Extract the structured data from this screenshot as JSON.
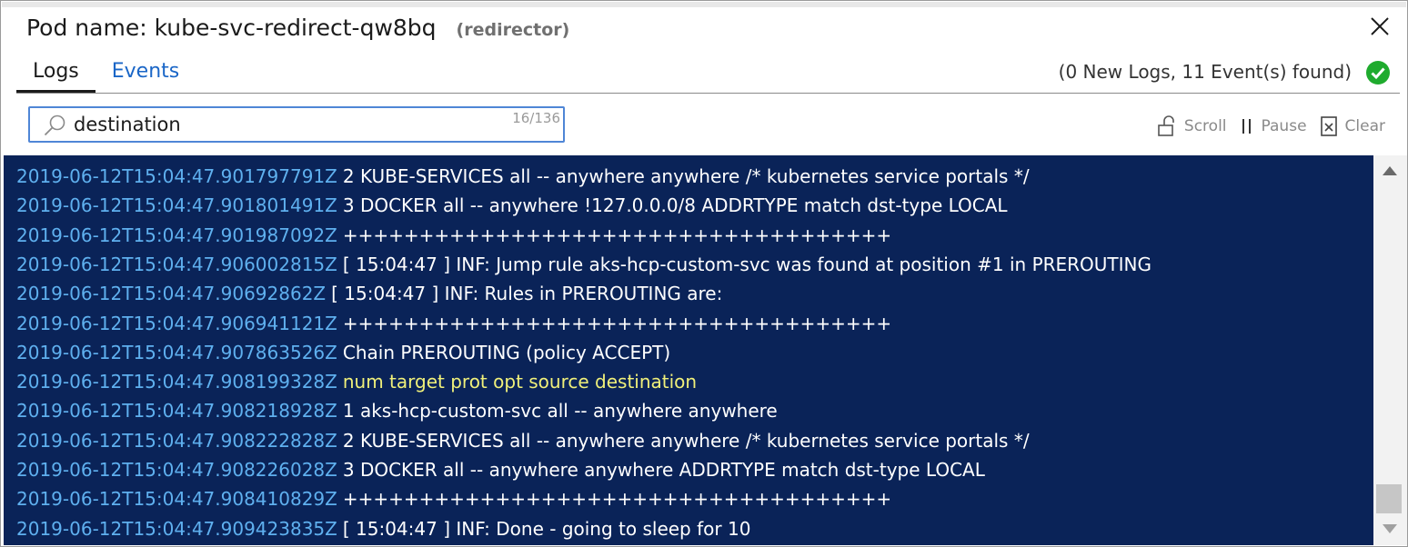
{
  "header": {
    "pod_label": "Pod name: kube-svc-redirect-qw8bq",
    "pod_role": "(redirector)",
    "close_icon": "close-icon"
  },
  "tabs": [
    {
      "label": "Logs",
      "active": true
    },
    {
      "label": "Events",
      "active": false
    }
  ],
  "status": {
    "text": "(0 New Logs, 11 Event(s) found)",
    "icon": "check-circle-icon",
    "color": "#1fab2e"
  },
  "search": {
    "value": "destination",
    "placeholder": "",
    "match_count": "16/136"
  },
  "toolbar": {
    "scroll_label": "Scroll",
    "pause_label": "Pause",
    "clear_label": "Clear"
  },
  "colors": {
    "log_background": "#0a2358",
    "timestamp": "#5fb0ef",
    "message": "#ffffff",
    "highlight": "#f0f07a",
    "accent": "#1a66c7"
  },
  "logs": [
    {
      "ts": "2019-06-12T15:04:47.901797791Z",
      "msg": "2 KUBE-SERVICES all -- anywhere anywhere /* kubernetes service portals */",
      "highlight": false
    },
    {
      "ts": "2019-06-12T15:04:47.901801491Z",
      "msg": "3 DOCKER all -- anywhere !127.0.0.0/8 ADDRTYPE match dst-type LOCAL",
      "highlight": false
    },
    {
      "ts": "2019-06-12T15:04:47.901987092Z",
      "msg": "++++++++++++++++++++++++++++++++++++",
      "highlight": false
    },
    {
      "ts": "2019-06-12T15:04:47.906002815Z",
      "msg": "[ 15:04:47 ] INF: Jump rule aks-hcp-custom-svc was found at position #1 in PREROUTING",
      "highlight": false
    },
    {
      "ts": "2019-06-12T15:04:47.90692862Z",
      "msg": "[ 15:04:47 ] INF: Rules in PREROUTING are:",
      "highlight": false
    },
    {
      "ts": "2019-06-12T15:04:47.906941121Z",
      "msg": "++++++++++++++++++++++++++++++++++++",
      "highlight": false
    },
    {
      "ts": "2019-06-12T15:04:47.907863526Z",
      "msg": "Chain PREROUTING (policy ACCEPT)",
      "highlight": false
    },
    {
      "ts": "2019-06-12T15:04:47.908199328Z",
      "msg": "num target prot opt source destination",
      "highlight": true
    },
    {
      "ts": "2019-06-12T15:04:47.908218928Z",
      "msg": "1 aks-hcp-custom-svc all -- anywhere anywhere",
      "highlight": false
    },
    {
      "ts": "2019-06-12T15:04:47.908222828Z",
      "msg": "2 KUBE-SERVICES all -- anywhere anywhere /* kubernetes service portals */",
      "highlight": false
    },
    {
      "ts": "2019-06-12T15:04:47.908226028Z",
      "msg": "3 DOCKER all -- anywhere anywhere ADDRTYPE match dst-type LOCAL",
      "highlight": false
    },
    {
      "ts": "2019-06-12T15:04:47.908410829Z",
      "msg": "++++++++++++++++++++++++++++++++++++",
      "highlight": false
    },
    {
      "ts": "2019-06-12T15:04:47.909423835Z",
      "msg": "[ 15:04:47 ] INF: Done - going to sleep for 10",
      "highlight": false
    }
  ],
  "scrollbar": {
    "position": 0.95
  }
}
